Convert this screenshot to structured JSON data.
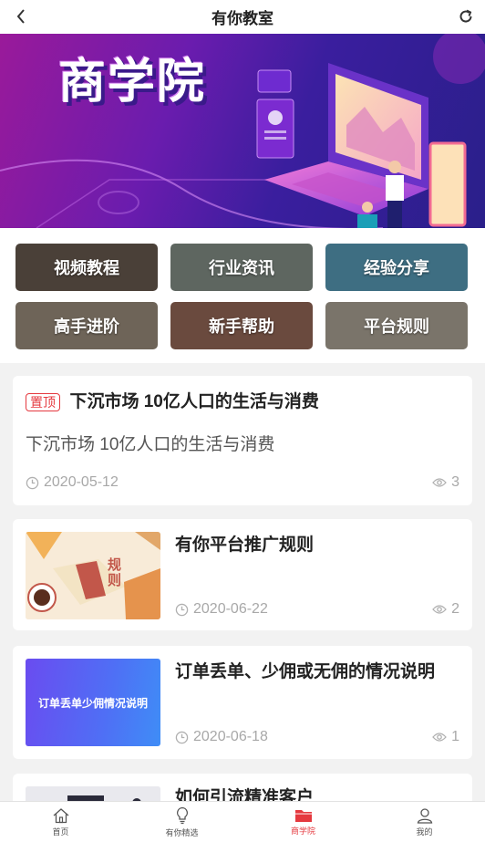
{
  "header": {
    "title": "有你教室",
    "back_icon": "chevron-left-icon",
    "refresh_icon": "refresh-icon"
  },
  "banner": {
    "title": "商学院"
  },
  "categories": [
    {
      "label": "视频教程",
      "color": "#4a4038"
    },
    {
      "label": "行业资讯",
      "color": "#5e6660"
    },
    {
      "label": "经验分享",
      "color": "#3e6e82"
    },
    {
      "label": "高手进阶",
      "color": "#6e6458"
    },
    {
      "label": "新手帮助",
      "color": "#6a4a3e"
    },
    {
      "label": "平台规则",
      "color": "#7a746a"
    }
  ],
  "articles": [
    {
      "pinned": true,
      "pin_label": "置顶",
      "title": "下沉市场 10亿人口的生活与消费",
      "summary": "下沉市场 10亿人口的生活与消费",
      "date": "2020-05-12",
      "views": "3"
    },
    {
      "title": "有你平台推广规则",
      "thumb_text": "规则",
      "date": "2020-06-22",
      "views": "2"
    },
    {
      "title": "订单丢单、少佣或无佣的情况说明",
      "thumb_text": "订单丢单少佣情况说明",
      "date": "2020-06-18",
      "views": "1"
    },
    {
      "title": "如何引流精准客户"
    }
  ],
  "tabbar": {
    "items": [
      {
        "label": "首页",
        "icon": "home-icon"
      },
      {
        "label": "有你精选",
        "icon": "lightbulb-icon"
      },
      {
        "label": "商学院",
        "icon": "folder-icon",
        "active": true
      },
      {
        "label": "我的",
        "icon": "user-icon"
      }
    ],
    "active_color": "#e5393f"
  }
}
